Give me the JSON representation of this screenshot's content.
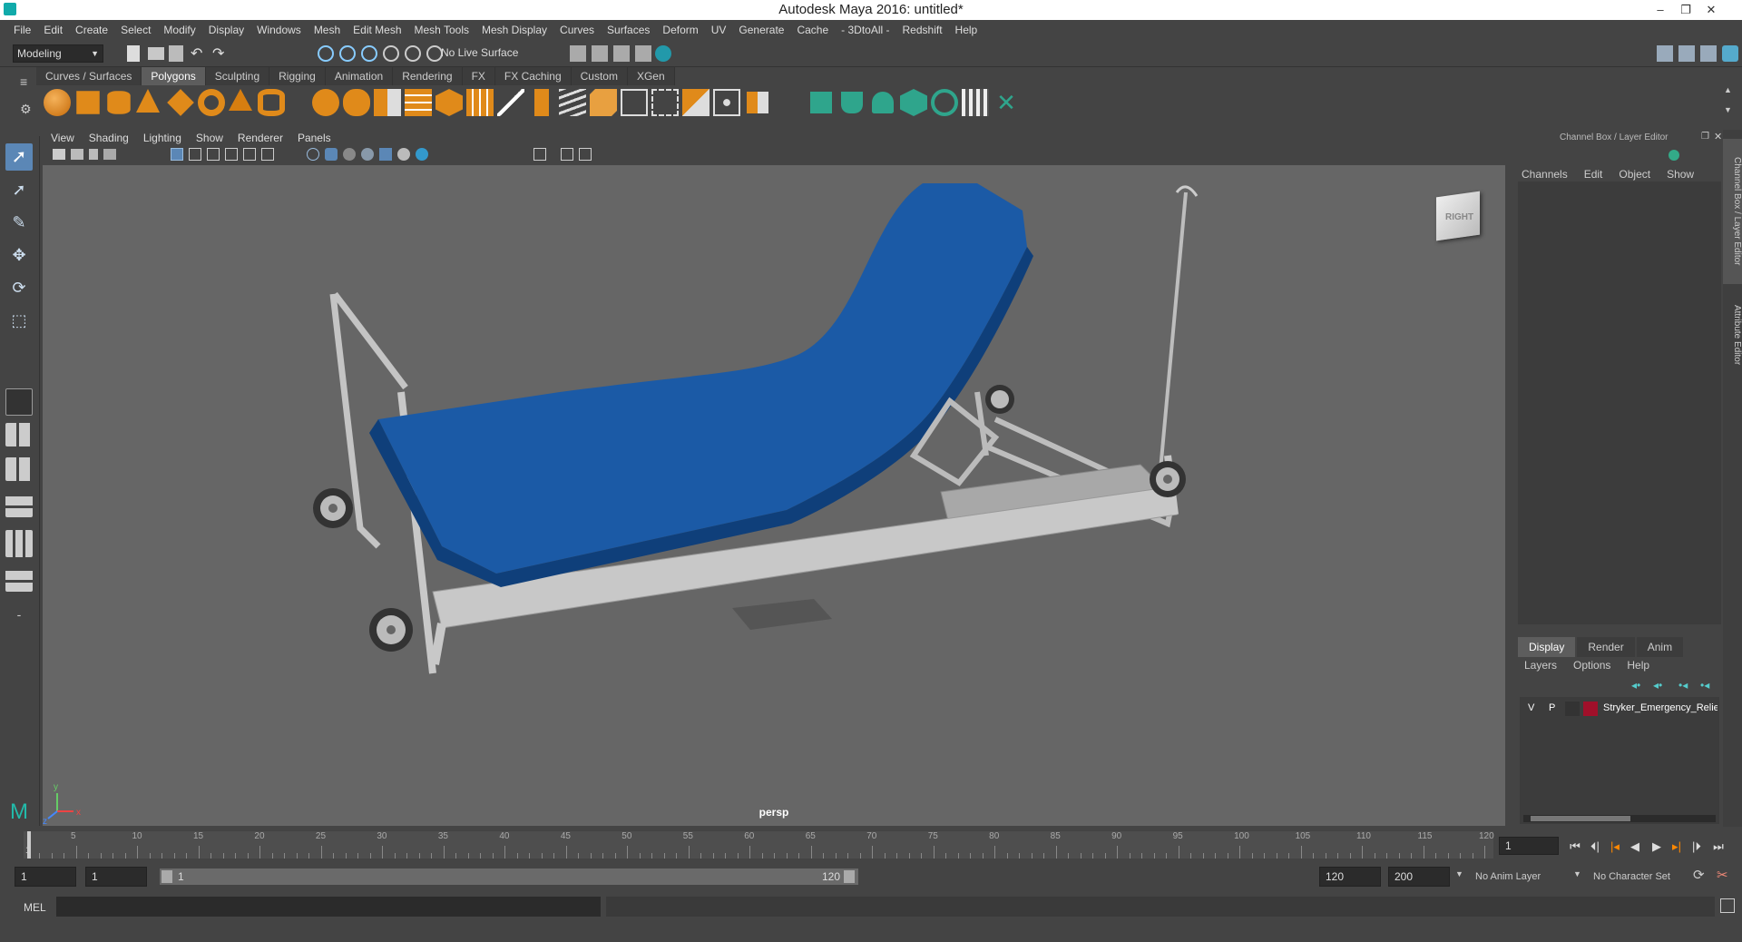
{
  "window": {
    "title": "Autodesk Maya 2016: untitled*"
  },
  "menus": [
    "File",
    "Edit",
    "Create",
    "Select",
    "Modify",
    "Display",
    "Windows",
    "Mesh",
    "Edit Mesh",
    "Mesh Tools",
    "Mesh Display",
    "Curves",
    "Surfaces",
    "Deform",
    "UV",
    "Generate",
    "Cache",
    "- 3DtoAll -",
    "Redshift",
    "Help"
  ],
  "status_line": {
    "mode": "Modeling",
    "live_surface": "No Live Surface"
  },
  "shelf": {
    "tabs": [
      "Curves / Surfaces",
      "Polygons",
      "Sculpting",
      "Rigging",
      "Animation",
      "Rendering",
      "FX",
      "FX Caching",
      "Custom",
      "XGen"
    ],
    "active_tab": "Polygons"
  },
  "panel_menu": [
    "View",
    "Shading",
    "Lighting",
    "Show",
    "Renderer",
    "Panels"
  ],
  "viewport": {
    "camera": "persp",
    "view_cube_face": "RIGHT",
    "axis_x": "x",
    "axis_y": "y",
    "axis_z": "z"
  },
  "channel_box": {
    "title": "Channel Box / Layer Editor",
    "menu": [
      "Channels",
      "Edit",
      "Object",
      "Show"
    ]
  },
  "side_tabs": [
    "Channel Box / Layer Editor",
    "Attribute Editor"
  ],
  "layer_editor": {
    "tabs": [
      "Display",
      "Render",
      "Anim"
    ],
    "active_tab": "Display",
    "menu": [
      "Layers",
      "Options",
      "Help"
    ],
    "layers": [
      {
        "visible": "V",
        "playback": "P",
        "name": "Stryker_Emergency_Relie",
        "color": "#a0102a"
      }
    ]
  },
  "time_slider": {
    "ticks": [
      5,
      10,
      15,
      20,
      25,
      30,
      35,
      40,
      45,
      50,
      55,
      60,
      65,
      70,
      75,
      80,
      85,
      90,
      95,
      100,
      105,
      110,
      115,
      120
    ],
    "start_label": "1",
    "current_frame": "1",
    "min": 1,
    "max": 120
  },
  "range_slider": {
    "start_time": "1",
    "playback_start": "1",
    "range_start_label": "1",
    "range_end_label": "120",
    "playback_end": "120",
    "end_time": "200",
    "anim_layer": "No Anim Layer",
    "character_set": "No Character Set"
  },
  "command_line": {
    "label": "MEL"
  },
  "colors": {
    "mattress": "#1b5aa6",
    "frame": "#c8c8c8",
    "viewport_bg": "#666666",
    "accent_icon": "#2fa58c",
    "shelf_orange": "#e0891a"
  }
}
